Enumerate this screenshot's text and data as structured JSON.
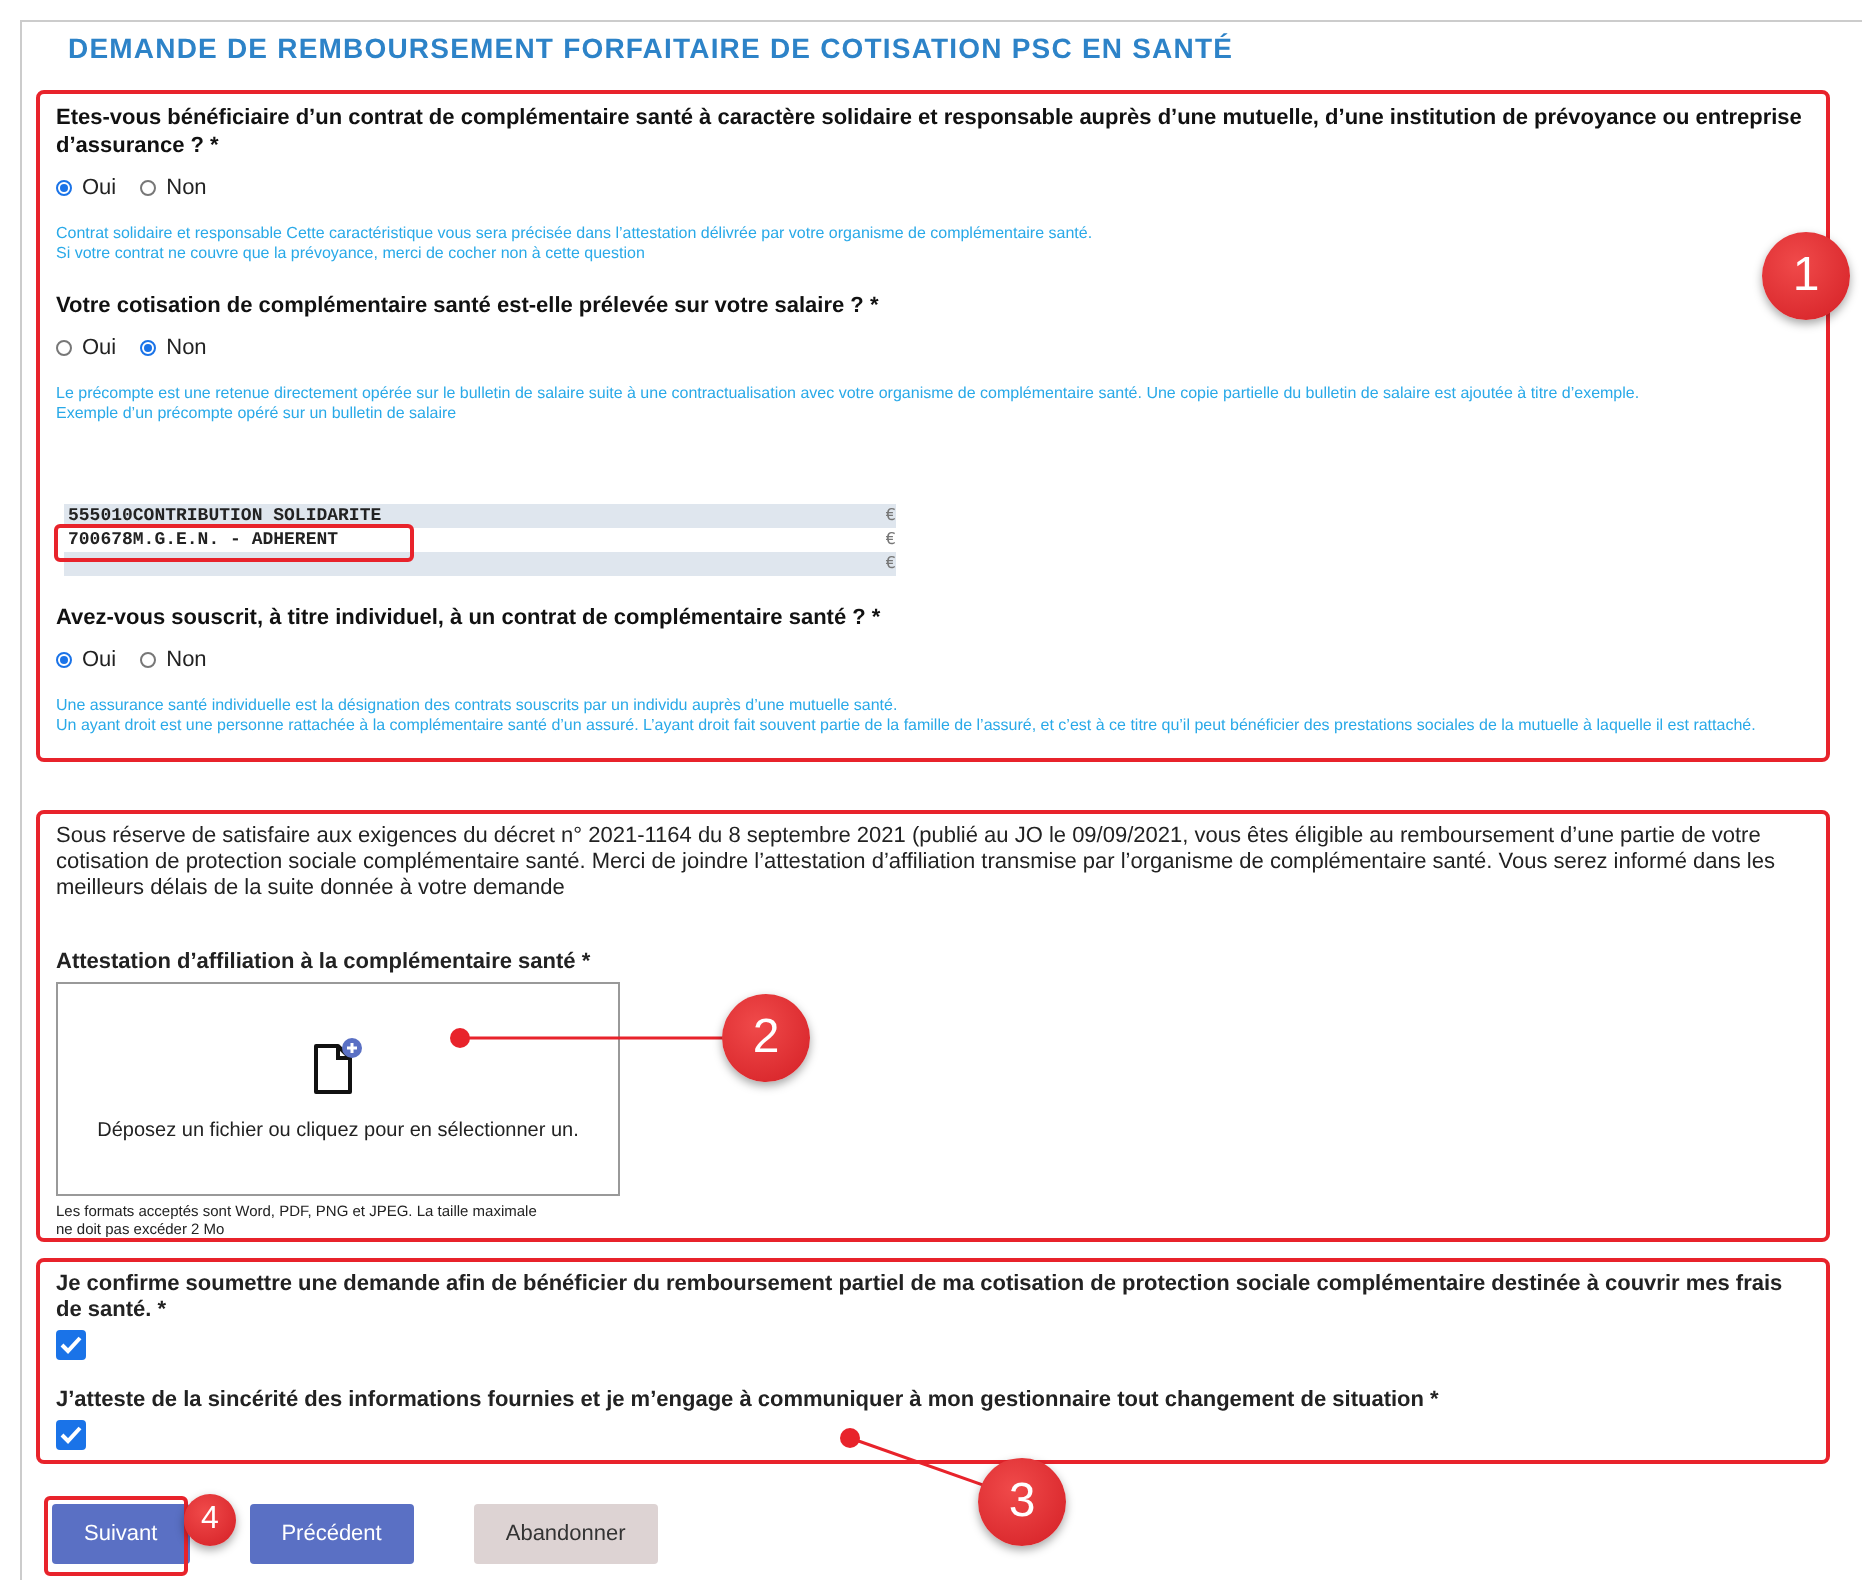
{
  "title": "DEMANDE DE REMBOURSEMENT FORFAITAIRE DE COTISATION PSC EN SANTÉ",
  "questions": [
    {
      "label": "Etes-vous bénéficiaire d’un contrat de complémentaire santé à caractère solidaire et responsable auprès d’une mutuelle, d’une institution de prévoyance ou entreprise d’assurance ? *",
      "options": [
        {
          "label": "Oui",
          "selected": true
        },
        {
          "label": "Non",
          "selected": false
        }
      ],
      "help": [
        "Contrat solidaire et responsable Cette caractéristique vous sera précisée dans l’attestation délivrée par votre organisme de complémentaire santé.",
        "Si votre contrat ne couvre que la prévoyance, merci de cocher non à cette question"
      ]
    },
    {
      "label": "Votre cotisation de complémentaire santé est-elle prélevée sur votre salaire ? *",
      "options": [
        {
          "label": "Oui",
          "selected": false
        },
        {
          "label": "Non",
          "selected": true
        }
      ],
      "help": [
        "Le précompte est une retenue directement opérée sur le bulletin de salaire suite à une contractualisation avec votre organisme de complémentaire santé. Une copie partielle du bulletin de salaire est ajoutée à titre d’exemple.",
        "Exemple d’un précompte opéré sur un bulletin de salaire"
      ],
      "payslip": [
        {
          "code": "555010",
          "label": "CONTRIBUTION SOLIDARITE",
          "currency": "€"
        },
        {
          "code": "700678",
          "label": "M.G.E.N. - ADHERENT",
          "currency": "€"
        },
        {
          "currency": "€"
        }
      ]
    },
    {
      "label": "Avez-vous souscrit, à titre individuel, à un contrat de complémentaire santé ? *",
      "options": [
        {
          "label": "Oui",
          "selected": true
        },
        {
          "label": "Non",
          "selected": false
        }
      ],
      "help": [
        "Une assurance santé individuelle est la désignation des contrats souscrits par un individu auprès d’une mutuelle santé.",
        "Un ayant droit est une personne rattachée à la complémentaire santé d’un assuré. L’ayant droit fait souvent partie de la famille de l’assuré, et c’est à ce titre qu’il peut bénéficier des prestations sociales de la mutuelle à laquelle il est rattaché."
      ]
    }
  ],
  "upload": {
    "notice": "Sous réserve de satisfaire aux exigences du décret n° 2021-1164 du 8 septembre 2021 (publié au JO le 09/09/2021, vous êtes éligible au remboursement d’une partie de votre cotisation de protection sociale complémentaire santé. Merci de joindre l’attestation d’affiliation transmise par l’organisme de complémentaire santé. Vous serez informé dans les meilleurs délais de la suite donnée à votre demande",
    "label": "Attestation d’affiliation à la complémentaire santé *",
    "dropzone": "Déposez un fichier ou cliquez pour en sélectionner un.",
    "hint": "Les formats acceptés sont Word, PDF, PNG et JPEG. La taille maximale ne doit pas excéder 2 Mo"
  },
  "confirmations": [
    {
      "label": "Je confirme soumettre une demande afin de bénéficier du remboursement partiel de ma cotisation de protection sociale complémentaire destinée à couvrir mes frais de santé. *",
      "checked": true
    },
    {
      "label": "J’atteste de la sincérité des informations fournies et je m’engage à communiquer à mon gestionnaire tout changement de situation *",
      "checked": true
    }
  ],
  "buttons": [
    {
      "label": "Suivant",
      "kind": "primary"
    },
    {
      "label": "Précédent",
      "kind": "primary"
    },
    {
      "label": "Abandonner",
      "kind": "secondary"
    }
  ],
  "callouts": [
    {
      "number": "1"
    },
    {
      "number": "2"
    },
    {
      "number": "3"
    },
    {
      "number": "4"
    }
  ]
}
